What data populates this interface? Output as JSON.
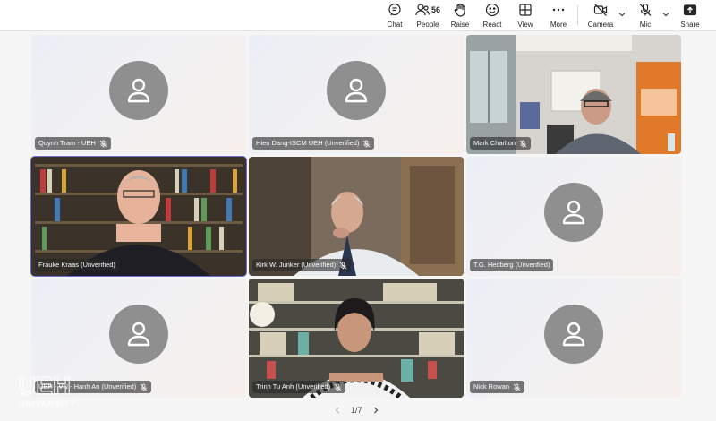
{
  "toolbar": {
    "chat": {
      "label": "Chat",
      "icon": "chat-icon"
    },
    "people": {
      "label": "People",
      "count": "56",
      "icon": "people-icon"
    },
    "raise": {
      "label": "Raise",
      "icon": "hand-icon"
    },
    "react": {
      "label": "React",
      "icon": "smile-icon"
    },
    "view": {
      "label": "View",
      "icon": "grid-icon"
    },
    "more": {
      "label": "More",
      "icon": "ellipsis-icon"
    },
    "camera": {
      "label": "Camera",
      "icon": "camera-off-icon"
    },
    "mic": {
      "label": "Mic",
      "icon": "mic-off-icon"
    },
    "share": {
      "label": "Share",
      "icon": "share-icon"
    }
  },
  "participants": [
    {
      "name": "Quynh Tram - UEH",
      "muted": true,
      "video": false
    },
    {
      "name": "Hien Dang-ISCM UEH (Unverified)",
      "muted": true,
      "video": false
    },
    {
      "name": "Mark Charlton",
      "muted": true,
      "video": true
    },
    {
      "name": "Frauke Kraas (Unverified)",
      "muted": false,
      "video": true
    },
    {
      "name": "Kirk W. Junker (Unverified)",
      "muted": true,
      "video": true
    },
    {
      "name": "T.G. Hedberg (Unverified)",
      "muted": false,
      "video": false
    },
    {
      "name": "UEH - VN - Hanh An (Unverified)",
      "muted": true,
      "video": false
    },
    {
      "name": "Trinh Tu Anh (Unverified)",
      "muted": true,
      "video": true
    },
    {
      "name": "Nick Rowan",
      "muted": true,
      "video": false
    }
  ],
  "pager": {
    "text": "1/7"
  },
  "watermark": {
    "line1": "UEH",
    "line2": "UNIVERSITY"
  },
  "colors": {
    "active_speaker_border": "#6b6fd6",
    "avatar": "#8f8f8f",
    "nametag_bg": "rgba(40,40,40,0.62)"
  }
}
